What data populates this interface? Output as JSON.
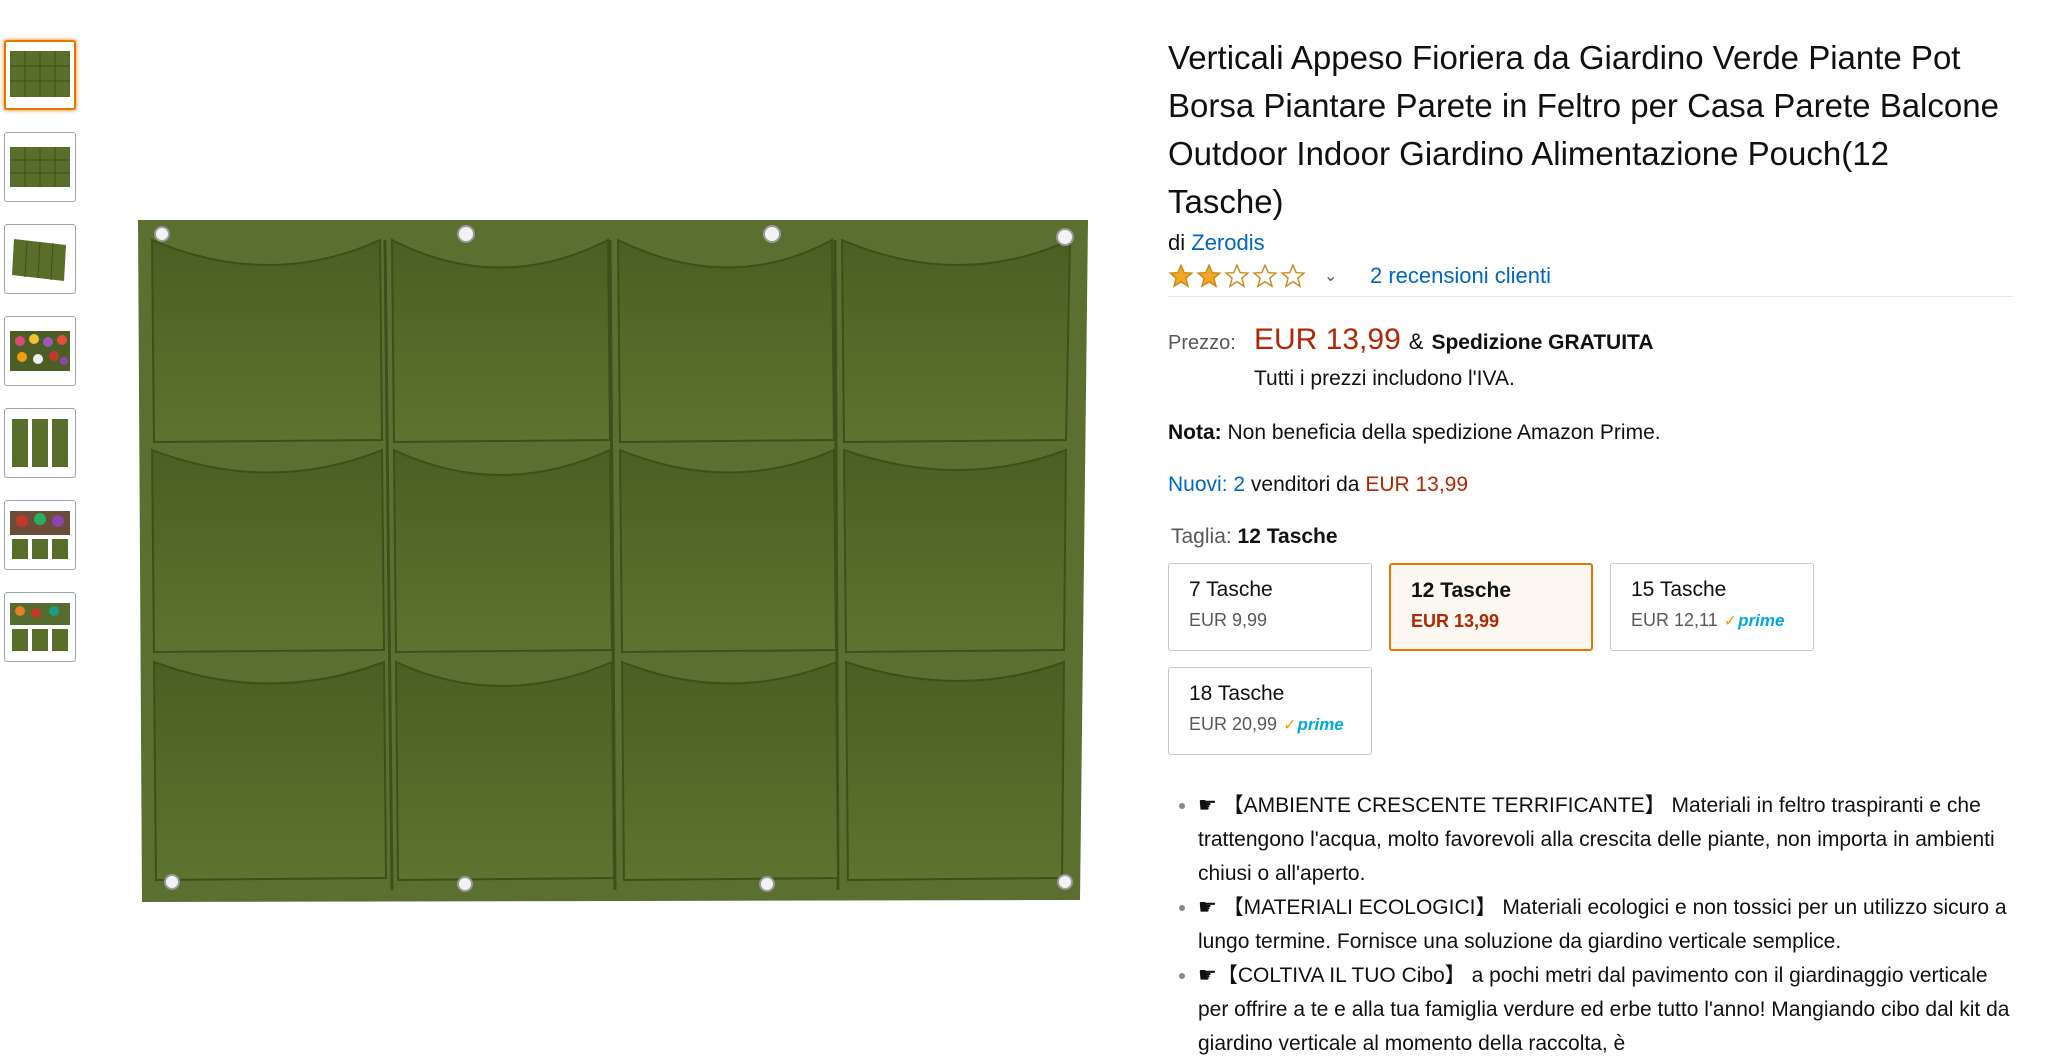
{
  "product": {
    "title": "Verticali Appeso Fioriera da Giardino Verde Piante Pot Borsa Piantare Parete in Feltro per Casa Parete Balcone Outdoor Indoor Giardino Alimentazione Pouch(12 Tasche)",
    "by_prefix": "di",
    "brand": "Zerodis",
    "rating_stars": 2,
    "max_stars": 5,
    "reviews_link": "2 recensioni clienti"
  },
  "price": {
    "label": "Prezzo:",
    "value": "EUR 13,99",
    "amp": "&",
    "shipping": "Spedizione GRATUITA",
    "vat_note": "Tutti i prezzi includono l'IVA."
  },
  "note": {
    "label": "Nota:",
    "text": "Non beneficia della spedizione Amazon Prime."
  },
  "offers": {
    "link": "Nuovi: 2",
    "text": "venditori da",
    "price": "EUR 13,99"
  },
  "size": {
    "label": "Taglia:",
    "selected": "12 Tasche",
    "options": [
      {
        "name": "7 Tasche",
        "price": "EUR 9,99",
        "prime": false
      },
      {
        "name": "12 Tasche",
        "price": "EUR 13,99",
        "prime": false
      },
      {
        "name": "15 Tasche",
        "price": "EUR 12,11",
        "prime": true
      },
      {
        "name": "18 Tasche",
        "price": "EUR 20,99",
        "prime": true
      }
    ],
    "prime_text": "prime"
  },
  "bullets": [
    "☛ 【AMBIENTE CRESCENTE TERRIFICANTE】 Materiali in feltro traspiranti e che trattengono l'acqua, molto favorevoli alla crescita delle piante, non importa in ambienti chiusi o all'aperto.",
    "☛ 【MATERIALI ECOLOGICI】 Materiali ecologici e non tossici per un utilizzo sicuro a lungo termine. Fornisce una soluzione da giardino verticale semplice.",
    "☛【COLTIVA IL TUO Cibo】 a pochi metri dal pavimento con il giardinaggio verticale per offrire a te e alla tua famiglia verdure ed erbe tutto l'anno! Mangiando cibo dal kit da giardino verticale al momento della raccolta, è"
  ],
  "colors": {
    "felt": "#556b2f",
    "accent": "#e77600",
    "link": "#0066c0",
    "price": "#b12704",
    "star": "#f5a623"
  }
}
